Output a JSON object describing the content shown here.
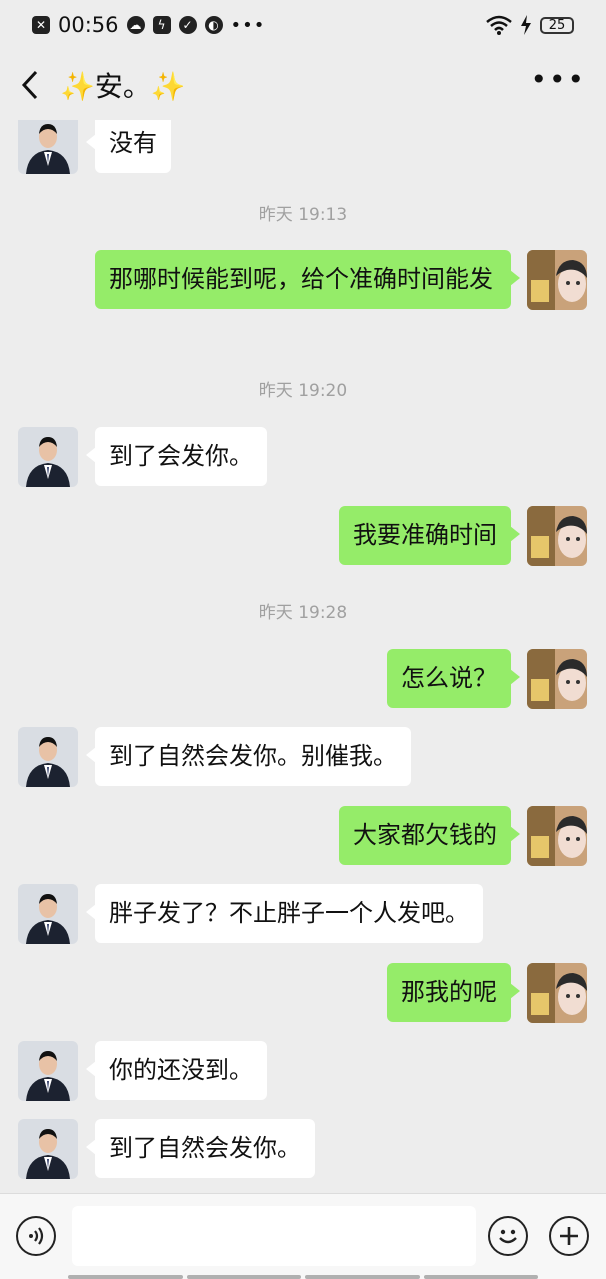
{
  "status": {
    "time": "00:56",
    "battery": "25",
    "dots": "•••"
  },
  "header": {
    "title": "安。",
    "sparkle": "✨",
    "more": "•••"
  },
  "messages": [
    {
      "side": "in",
      "text": "没有"
    },
    {
      "type": "time",
      "text": "昨天 19:13"
    },
    {
      "side": "out",
      "text": "那哪时候能到呢，给个准确时间能发"
    },
    {
      "type": "time",
      "text": "昨天 19:20"
    },
    {
      "side": "in",
      "text": "到了会发你。"
    },
    {
      "side": "out",
      "text": "我要准确时间"
    },
    {
      "type": "time",
      "text": "昨天 19:28"
    },
    {
      "side": "out",
      "text": "怎么说？"
    },
    {
      "side": "in",
      "text": "到了自然会发你。别催我。"
    },
    {
      "side": "out",
      "text": "大家都欠钱的"
    },
    {
      "side": "in",
      "text": "胖子发了？不止胖子一个人发吧。"
    },
    {
      "side": "out",
      "text": "那我的呢"
    },
    {
      "side": "in",
      "text": "你的还没到。"
    },
    {
      "side": "in",
      "text": "到了自然会发你。"
    }
  ],
  "input": {
    "placeholder": ""
  },
  "icons": {
    "back": "back-arrow-icon",
    "more": "more-icon",
    "voice": "voice-icon",
    "emoji": "emoji-icon",
    "add": "add-icon"
  },
  "colors": {
    "out_bubble": "#95ec69",
    "in_bubble": "#ffffff",
    "background": "#ededed"
  }
}
